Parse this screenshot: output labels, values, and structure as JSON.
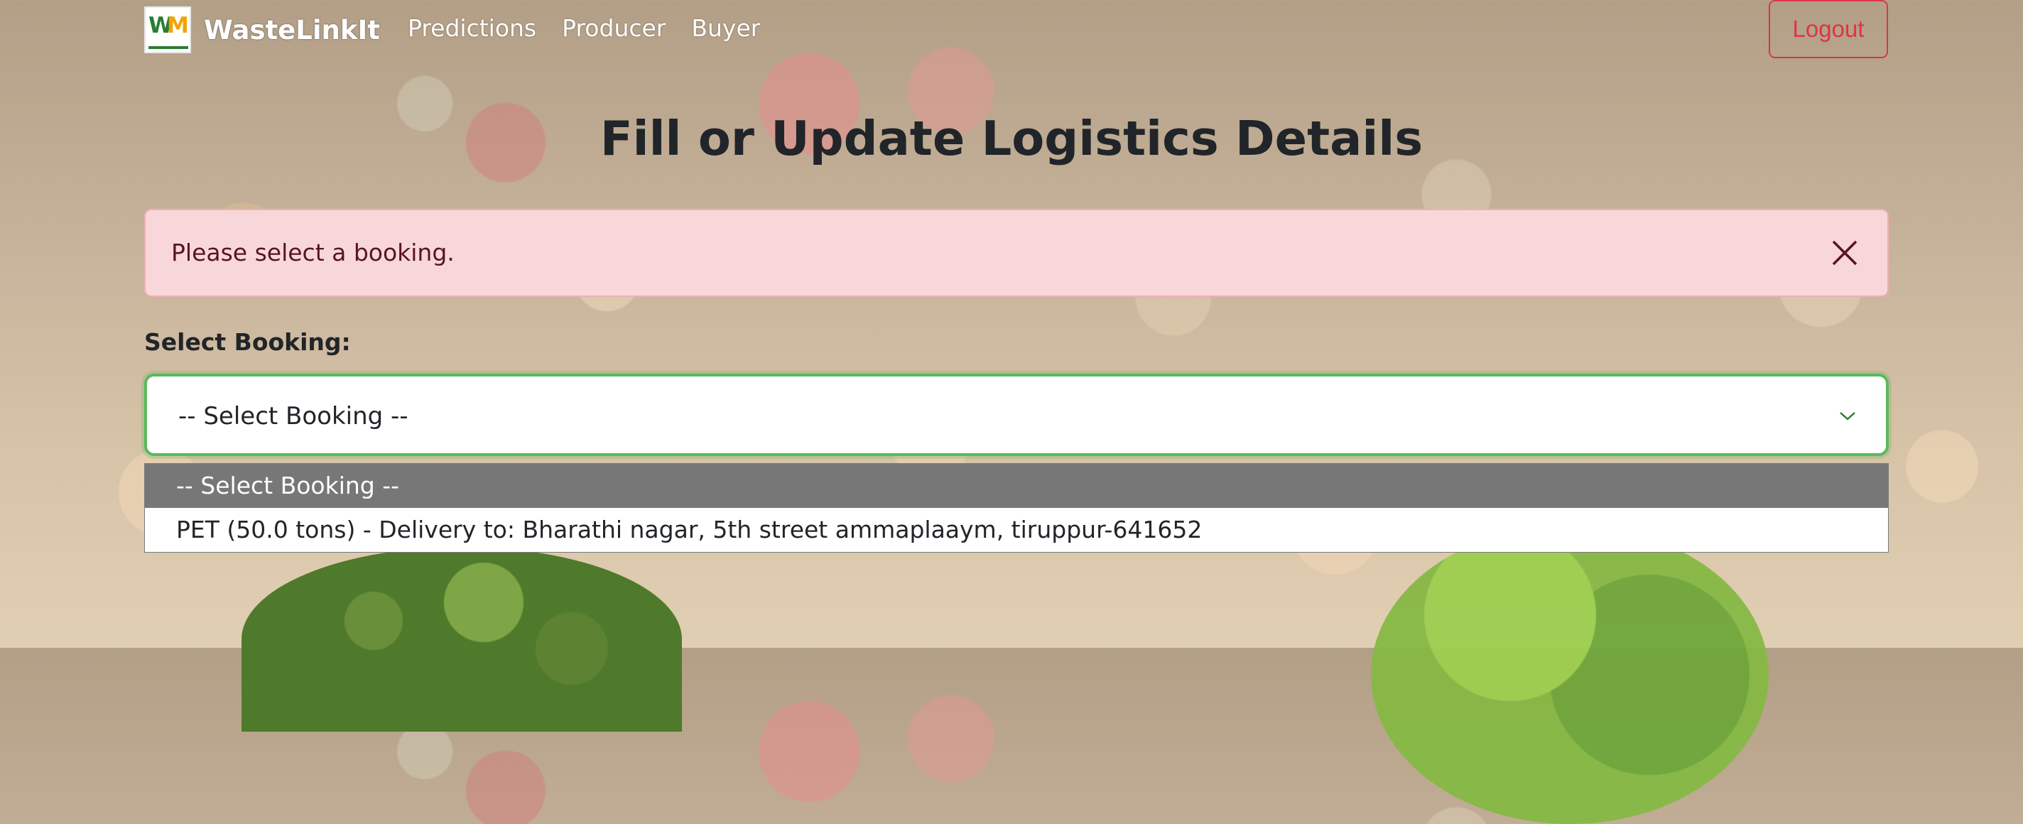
{
  "navbar": {
    "brand_name": "WasteLinkIt",
    "logo_letter_1": "W",
    "logo_letter_2": "M",
    "links": [
      "Predictions",
      "Producer",
      "Buyer"
    ],
    "logout_label": "Logout"
  },
  "page": {
    "title": "Fill or Update Logistics Details"
  },
  "alert": {
    "message": "Please select a booking.",
    "close_icon": "close-icon"
  },
  "form": {
    "select_label": "Select Booking:",
    "select_value": "-- Select Booking --",
    "options": [
      "-- Select Booking --",
      "PET (50.0 tons) - Delivery to: Bharathi nagar, 5th street ammaplaaym, tiruppur-641652"
    ]
  },
  "colors": {
    "alert_bg": "#f8d7da",
    "alert_text": "#58151c",
    "logout": "#dc3545",
    "focus_border": "#5cb85c",
    "selected_option": "#777777"
  }
}
